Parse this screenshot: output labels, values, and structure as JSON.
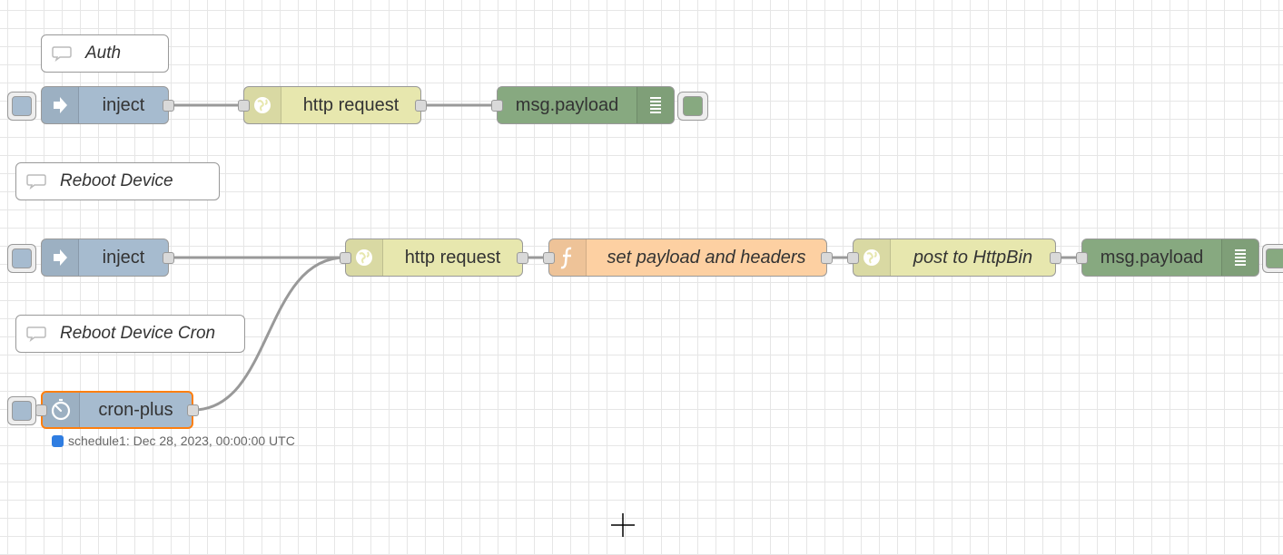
{
  "comments": {
    "auth": "Auth",
    "reboot": "Reboot Device",
    "reboot_cron": "Reboot Device Cron"
  },
  "nodes": {
    "inject1": "inject",
    "http1": "http request",
    "debug1": "msg.payload",
    "inject2": "inject",
    "http2": "http request",
    "func1": "set payload and headers",
    "post": "post to HttpBin",
    "debug2": "msg.payload",
    "cron": "cron-plus"
  },
  "status": {
    "cron": "schedule1: Dec 28, 2023, 00:00:00 UTC"
  },
  "icons": {
    "inject": "arrow-in-icon",
    "http": "globe-icon",
    "debug": "list-icon",
    "function": "function-icon",
    "cron": "timer-icon",
    "comment": "speech-bubble-icon"
  },
  "colors": {
    "inject": "#a6bbcf",
    "http": "#e7e7ae",
    "debug": "#87a980",
    "function": "#fdd0a2",
    "selected": "#ff7f0e",
    "status": "#2f7de1"
  }
}
